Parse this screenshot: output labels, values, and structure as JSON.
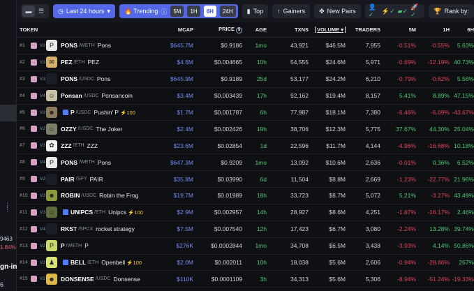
{
  "toolbar": {
    "time_label": "Last 24 hours",
    "trending_label": "Trending",
    "timeframes": [
      "5M",
      "1H",
      "6H",
      "24H"
    ],
    "active_timeframe": "6H",
    "top_label": "Top",
    "gainers_label": "Gainers",
    "new_pairs_label": "New Pairs",
    "rank_by_label": "Rank by:"
  },
  "left_fragments": {
    "a": "9463",
    "b": "1.84%",
    "c": "gn-in",
    "d": "6"
  },
  "headers": {
    "token": "TOKEN",
    "mcap": "MCAP",
    "price": "PRICE",
    "age": "AGE",
    "txns": "TXNS",
    "volume": "VOLUME",
    "traders": "TRADERS",
    "m5": "5M",
    "h1": "1H",
    "h6": "6H"
  },
  "colors": {
    "accent": "#5268e6",
    "positive": "#4fc86e",
    "negative": "#e2455a",
    "mcap": "#6e8ef0"
  },
  "rows": [
    {
      "rank": "#1",
      "ver": "V2",
      "logo_bg": "#e9e9e9",
      "logo_icon": "P",
      "symbol": "PONS",
      "pair": "/WETH",
      "name": "Pons",
      "boost": "",
      "mcap": "$645.7M",
      "price": "$0.9186",
      "age": "1mo",
      "txns": "43,921",
      "volume": "$46.5M",
      "traders": "7,955",
      "m5": "-0.51%",
      "h1": "-0.55%",
      "h6": "5.63%"
    },
    {
      "rank": "#2",
      "ver": "V3",
      "logo_bg": "#d6b06a",
      "logo_icon": "✉",
      "symbol": "PEZ",
      "pair": "/ETH",
      "name": "PEZ",
      "boost": "",
      "mcap": "$4.6M",
      "price": "$0.004665",
      "age": "10h",
      "txns": "54,555",
      "volume": "$24.6M",
      "traders": "5,971",
      "m5": "-0.69%",
      "h1": "-12.19%",
      "h6": "40.73%"
    },
    {
      "rank": "#3",
      "ver": "V3",
      "logo_bg": "#1b1d24",
      "logo_icon": "∩",
      "symbol": "PONS",
      "pair": "/USDC",
      "name": "Pons",
      "boost": "",
      "mcap": "$645.9M",
      "price": "$0.9189",
      "age": "25d",
      "txns": "53,177",
      "volume": "$24.2M",
      "traders": "6,210",
      "m5": "-0.79%",
      "h1": "-0.62%",
      "h6": "5.56%"
    },
    {
      "rank": "#4",
      "ver": "V4",
      "logo_bg": "#c9c3a8",
      "logo_icon": "☺",
      "symbol": "Ponsan",
      "pair": "/USDC",
      "name": "Ponsancoin",
      "boost": "",
      "mcap": "$3.4M",
      "price": "$0.003439",
      "age": "17h",
      "txns": "92,162",
      "volume": "$19.4M",
      "traders": "8,157",
      "m5": "5.41%",
      "h1": "8.89%",
      "h6": "47.15%"
    },
    {
      "rank": "#5",
      "ver": "V2",
      "logo_bg": "#8a7b5c",
      "logo_icon": "☻",
      "symbol": "P",
      "pair": "/USDC",
      "name": "Pushin' P",
      "boost": "100",
      "mcap": "$1.7M",
      "price": "$0.001787",
      "age": "6h",
      "txns": "77,987",
      "volume": "$18.1M",
      "traders": "7,380",
      "m5": "-6.46%",
      "h1": "-6.09%",
      "h6": "-43.67%"
    },
    {
      "rank": "#6",
      "ver": "V2",
      "logo_bg": "#7a7f68",
      "logo_icon": "☺",
      "symbol": "OZZY",
      "pair": "/USDC",
      "name": "The Joker",
      "boost": "",
      "mcap": "$2.4M",
      "price": "$0.002426",
      "age": "19h",
      "txns": "38,706",
      "volume": "$12.3M",
      "traders": "5,775",
      "m5": "37.67%",
      "h1": "44.30%",
      "h6": "25.04%"
    },
    {
      "rank": "#7",
      "ver": "V3",
      "logo_bg": "#f2f2f2",
      "logo_icon": "✿",
      "symbol": "ZZZ",
      "pair": "/ETH",
      "name": "ZZZ",
      "boost": "",
      "mcap": "$23.6M",
      "price": "$0.02854",
      "age": "1d",
      "txns": "22,596",
      "volume": "$11.7M",
      "traders": "4,144",
      "m5": "-4.96%",
      "h1": "-16.68%",
      "h6": "10.18%"
    },
    {
      "rank": "#8",
      "ver": "V4",
      "logo_bg": "#e9e9e9",
      "logo_icon": "P",
      "symbol": "PONS",
      "pair": "/WETH",
      "name": "Pons",
      "boost": "",
      "mcap": "$647.3M",
      "price": "$0.9209",
      "age": "1mo",
      "txns": "13,092",
      "volume": "$10.6M",
      "traders": "2,636",
      "m5": "-0.01%",
      "h1": "0.36%",
      "h6": "6.52%"
    },
    {
      "rank": "#9",
      "ver": "V2",
      "logo_bg": "#1b1d24",
      "logo_icon": "☾",
      "symbol": "PAIR",
      "pair": "/SPY",
      "name": "PAIR",
      "boost": "",
      "mcap": "$35.8M",
      "price": "$0.03990",
      "age": "6d",
      "txns": "11,504",
      "volume": "$8.8M",
      "traders": "2,669",
      "m5": "-1.23%",
      "h1": "-22.77%",
      "h6": "21.96%"
    },
    {
      "rank": "#10",
      "ver": "V3",
      "logo_bg": "#8a9a3c",
      "logo_icon": "☻",
      "symbol": "ROBIN",
      "pair": "/USDC",
      "name": "Robin the Frog",
      "boost": "",
      "mcap": "$19.7M",
      "price": "$0.01989",
      "age": "18h",
      "txns": "33,723",
      "volume": "$8.7M",
      "traders": "5,072",
      "m5": "5.21%",
      "h1": "-3.27%",
      "h6": "43.49%"
    },
    {
      "rank": "#11",
      "ver": "V3",
      "logo_bg": "#5c6b3a",
      "logo_icon": "☺",
      "symbol": "UNIPCS",
      "pair": "/ETH",
      "name": "Unipcs",
      "boost": "100",
      "mcap": "$2.9M",
      "price": "$0.002957",
      "age": "14h",
      "txns": "28,927",
      "volume": "$8.6M",
      "traders": "4,251",
      "m5": "-1.87%",
      "h1": "-16.17%",
      "h6": "2.46%"
    },
    {
      "rank": "#12",
      "ver": "V4",
      "logo_bg": "#1b1d24",
      "logo_icon": "♞",
      "symbol": "RKST",
      "pair": "/SPCX",
      "name": "rocket strategy",
      "boost": "",
      "mcap": "$7.5M",
      "price": "$0.007540",
      "age": "12h",
      "txns": "17,423",
      "volume": "$6.7M",
      "traders": "3,080",
      "m5": "-2.24%",
      "h1": "13.28%",
      "h6": "39.74%"
    },
    {
      "rank": "#13",
      "ver": "V2",
      "logo_bg": "#c8d86a",
      "logo_icon": "P",
      "symbol": "P",
      "pair": "/WETH",
      "name": "P",
      "boost": "",
      "mcap": "$276K",
      "price": "$0.0002844",
      "age": "1mo",
      "txns": "34,708",
      "volume": "$6.5M",
      "traders": "3,438",
      "m5": "-3.93%",
      "h1": "4.14%",
      "h6": "50.86%"
    },
    {
      "rank": "#14",
      "ver": "V3",
      "logo_bg": "#d8e07a",
      "logo_icon": "♟",
      "symbol": "BELL",
      "pair": "/ETH",
      "name": "Openbell",
      "boost": "100",
      "mcap": "$2.0M",
      "price": "$0.002011",
      "age": "10h",
      "txns": "18,038",
      "volume": "$5.6M",
      "traders": "2,606",
      "m5": "-0.94%",
      "h1": "-28.86%",
      "h6": "267%"
    },
    {
      "rank": "#15",
      "ver": "V2",
      "logo_bg": "#e0b84a",
      "logo_icon": "☻",
      "symbol": "DONSENSE",
      "pair": "/USDC",
      "name": "Donsense",
      "boost": "",
      "mcap": "$110K",
      "price": "$0.0001109",
      "age": "3h",
      "txns": "34,313",
      "volume": "$5.6M",
      "traders": "5,306",
      "m5": "-8.94%",
      "h1": "-51.24%",
      "h6": "-19.33%"
    }
  ]
}
